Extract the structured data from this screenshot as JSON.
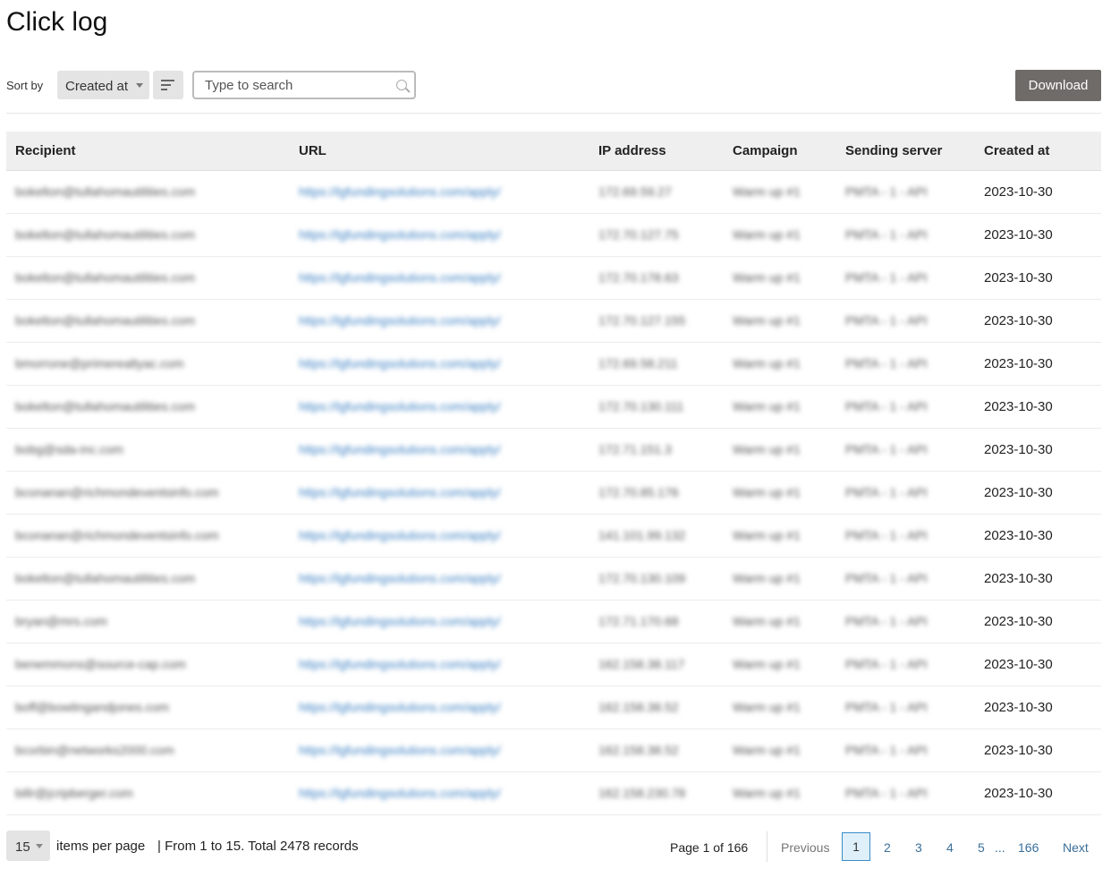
{
  "page": {
    "title": "Click log"
  },
  "toolbar": {
    "sort_label": "Sort by",
    "sort_value": "Created at",
    "search_placeholder": "Type to search",
    "download_label": "Download"
  },
  "table": {
    "columns": [
      "Recipient",
      "URL",
      "IP address",
      "Campaign",
      "Sending server",
      "Created at"
    ],
    "rows": [
      [
        "bokelton@tullahomautilities.com",
        "https://lgfundingsolutions.com/apply/",
        "172.69.59.27",
        "Warm up #1",
        "PMTA - 1 - API",
        "2023-10-30"
      ],
      [
        "bokelton@tullahomautilities.com",
        "https://lgfundingsolutions.com/apply/",
        "172.70.127.75",
        "Warm up #1",
        "PMTA - 1 - API",
        "2023-10-30"
      ],
      [
        "bokelton@tullahomautilities.com",
        "https://lgfundingsolutions.com/apply/",
        "172.70.178.63",
        "Warm up #1",
        "PMTA - 1 - API",
        "2023-10-30"
      ],
      [
        "bokelton@tullahomautilities.com",
        "https://lgfundingsolutions.com/apply/",
        "172.70.127.155",
        "Warm up #1",
        "PMTA - 1 - API",
        "2023-10-30"
      ],
      [
        "bmorrone@primerealtyac.com",
        "https://lgfundingsolutions.com/apply/",
        "172.69.58.211",
        "Warm up #1",
        "PMTA - 1 - API",
        "2023-10-30"
      ],
      [
        "bokelton@tullahomautilities.com",
        "https://lgfundingsolutions.com/apply/",
        "172.70.130.111",
        "Warm up #1",
        "PMTA - 1 - API",
        "2023-10-30"
      ],
      [
        "bobg@sda-inc.com",
        "https://lgfundingsolutions.com/apply/",
        "172.71.151.3",
        "Warm up #1",
        "PMTA - 1 - API",
        "2023-10-30"
      ],
      [
        "bconanan@richmondeventsinfo.com",
        "https://lgfundingsolutions.com/apply/",
        "172.70.85.176",
        "Warm up #1",
        "PMTA - 1 - API",
        "2023-10-30"
      ],
      [
        "bconanan@richmondeventsinfo.com",
        "https://lgfundingsolutions.com/apply/",
        "141.101.99.132",
        "Warm up #1",
        "PMTA - 1 - API",
        "2023-10-30"
      ],
      [
        "bokelton@tullahomautilities.com",
        "https://lgfundingsolutions.com/apply/",
        "172.70.130.109",
        "Warm up #1",
        "PMTA - 1 - API",
        "2023-10-30"
      ],
      [
        "bryan@mrs.com",
        "https://lgfundingsolutions.com/apply/",
        "172.71.170.68",
        "Warm up #1",
        "PMTA - 1 - API",
        "2023-10-30"
      ],
      [
        "benemmons@source-cap.com",
        "https://lgfundingsolutions.com/apply/",
        "162.158.38.117",
        "Warm up #1",
        "PMTA - 1 - API",
        "2023-10-30"
      ],
      [
        "boff@bowlingandjones.com",
        "https://lgfundingsolutions.com/apply/",
        "162.158.38.52",
        "Warm up #1",
        "PMTA - 1 - API",
        "2023-10-30"
      ],
      [
        "bcorbin@networks2000.com",
        "https://lgfundingsolutions.com/apply/",
        "162.158.38.52",
        "Warm up #1",
        "PMTA - 1 - API",
        "2023-10-30"
      ],
      [
        "billr@jcripberger.com",
        "https://lgfundingsolutions.com/apply/",
        "162.158.230.78",
        "Warm up #1",
        "PMTA - 1 - API",
        "2023-10-30"
      ]
    ]
  },
  "footer": {
    "per_page_value": "15",
    "per_page_label": "items per page",
    "records_text": "| From 1 to 15. Total 2478 records",
    "page_info": "Page 1 of 166",
    "previous_label": "Previous",
    "pages": [
      "1",
      "2",
      "3",
      "4",
      "5"
    ],
    "ellipsis": "...",
    "last_page": "166",
    "next_label": "Next"
  }
}
